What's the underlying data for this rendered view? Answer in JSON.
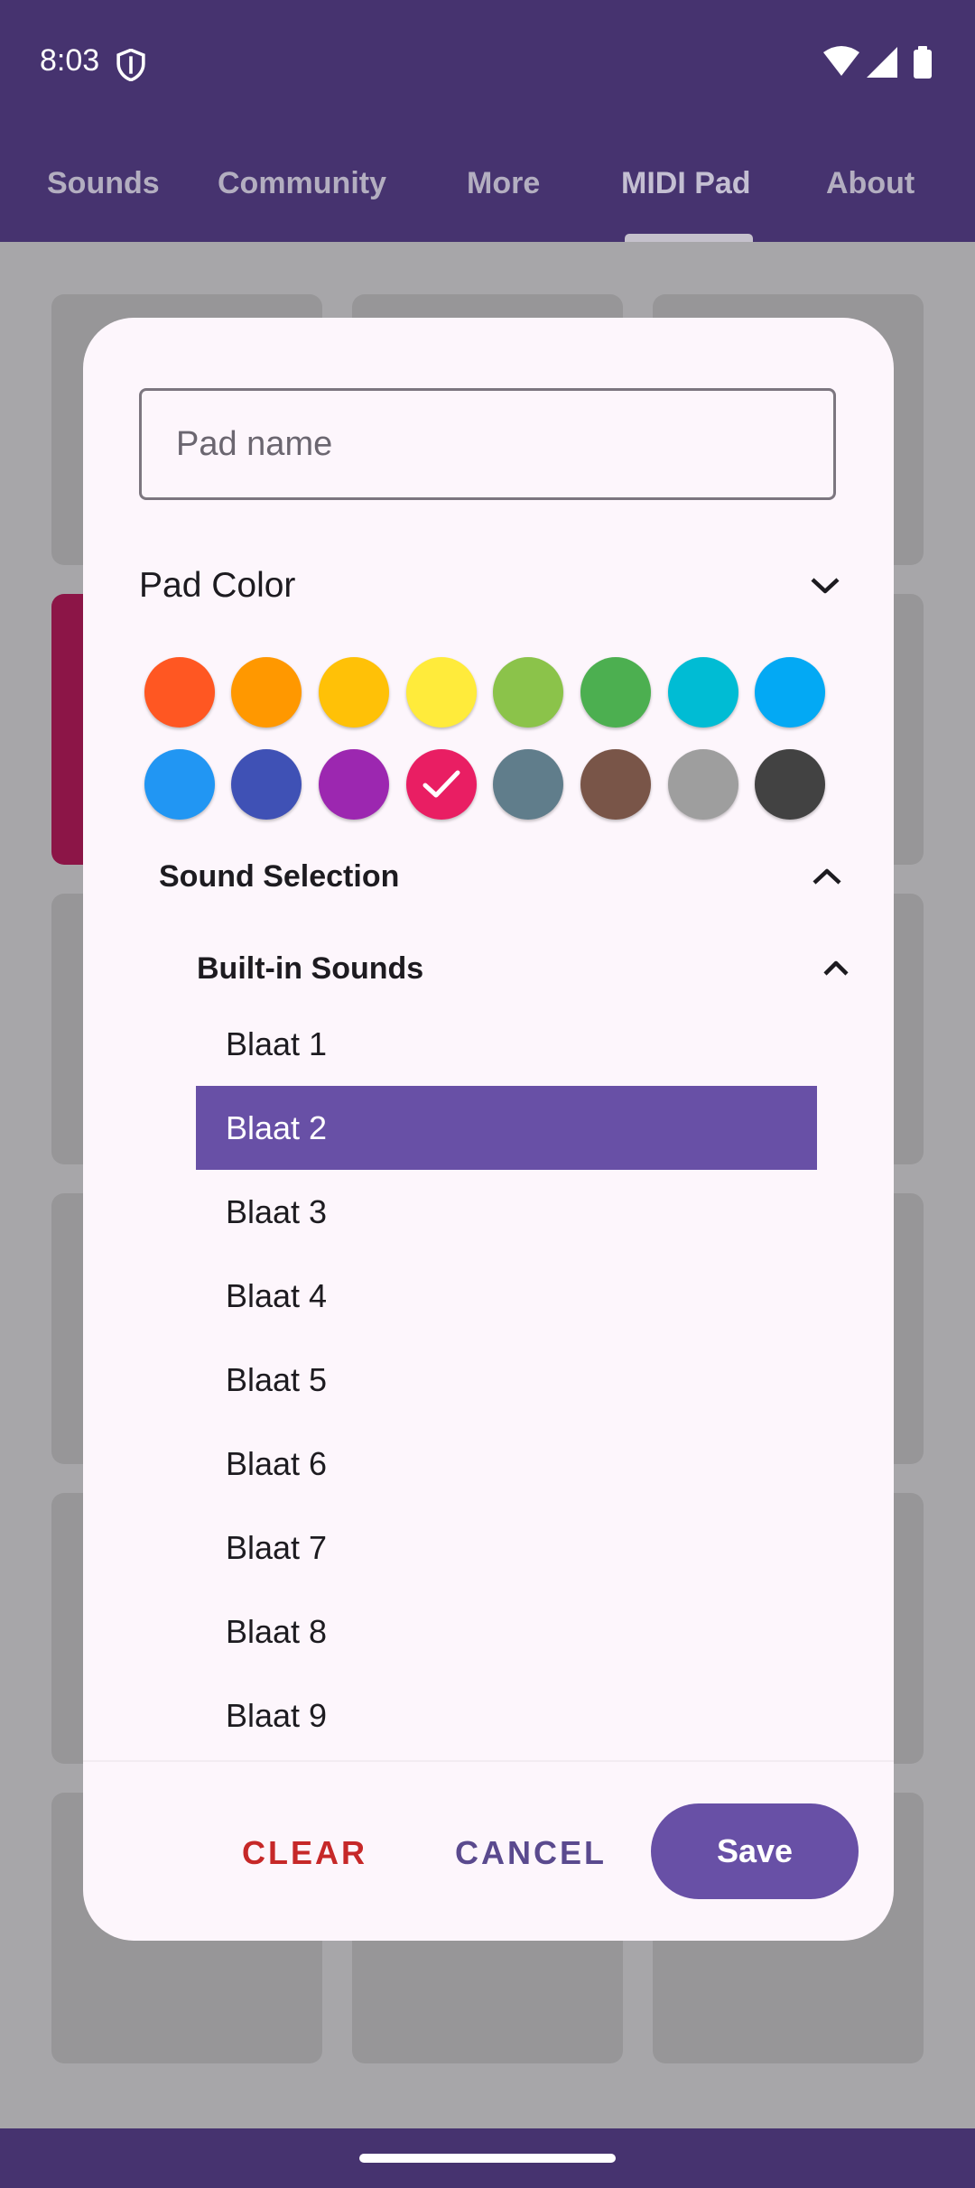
{
  "status_bar": {
    "time": "8:03"
  },
  "tabs": [
    {
      "label": "Sounds"
    },
    {
      "label": "Community"
    },
    {
      "label": "More"
    },
    {
      "label": "MIDI Pad"
    },
    {
      "label": "About"
    }
  ],
  "active_tab": "MIDI Pad",
  "dialog": {
    "pad_name_placeholder": "Pad name",
    "pad_name_value": "",
    "pad_color_label": "Pad Color",
    "selected_color": "#e91e63",
    "colors": [
      "#ff5722",
      "#ff9800",
      "#ffc107",
      "#ffeb3b",
      "#8bc34a",
      "#4caf50",
      "#00bcd4",
      "#03a9f4",
      "#2196f3",
      "#3f51b5",
      "#9c27b0",
      "#e91e63",
      "#607d8b",
      "#795548",
      "#9e9e9e",
      "#424242"
    ],
    "sound_selection_label": "Sound Selection",
    "builtin_sounds_label": "Built-in Sounds",
    "sounds": [
      "Blaat 1",
      "Blaat 2",
      "Blaat 3",
      "Blaat 4",
      "Blaat 5",
      "Blaat 6",
      "Blaat 7",
      "Blaat 8",
      "Blaat 9"
    ],
    "selected_sound": "Blaat 2",
    "clear_label": "CLEAR",
    "cancel_label": "CANCEL",
    "save_label": "Save"
  },
  "theme": {
    "primary": "#6850a6",
    "appbar": "#46336f",
    "danger": "#c62828"
  }
}
